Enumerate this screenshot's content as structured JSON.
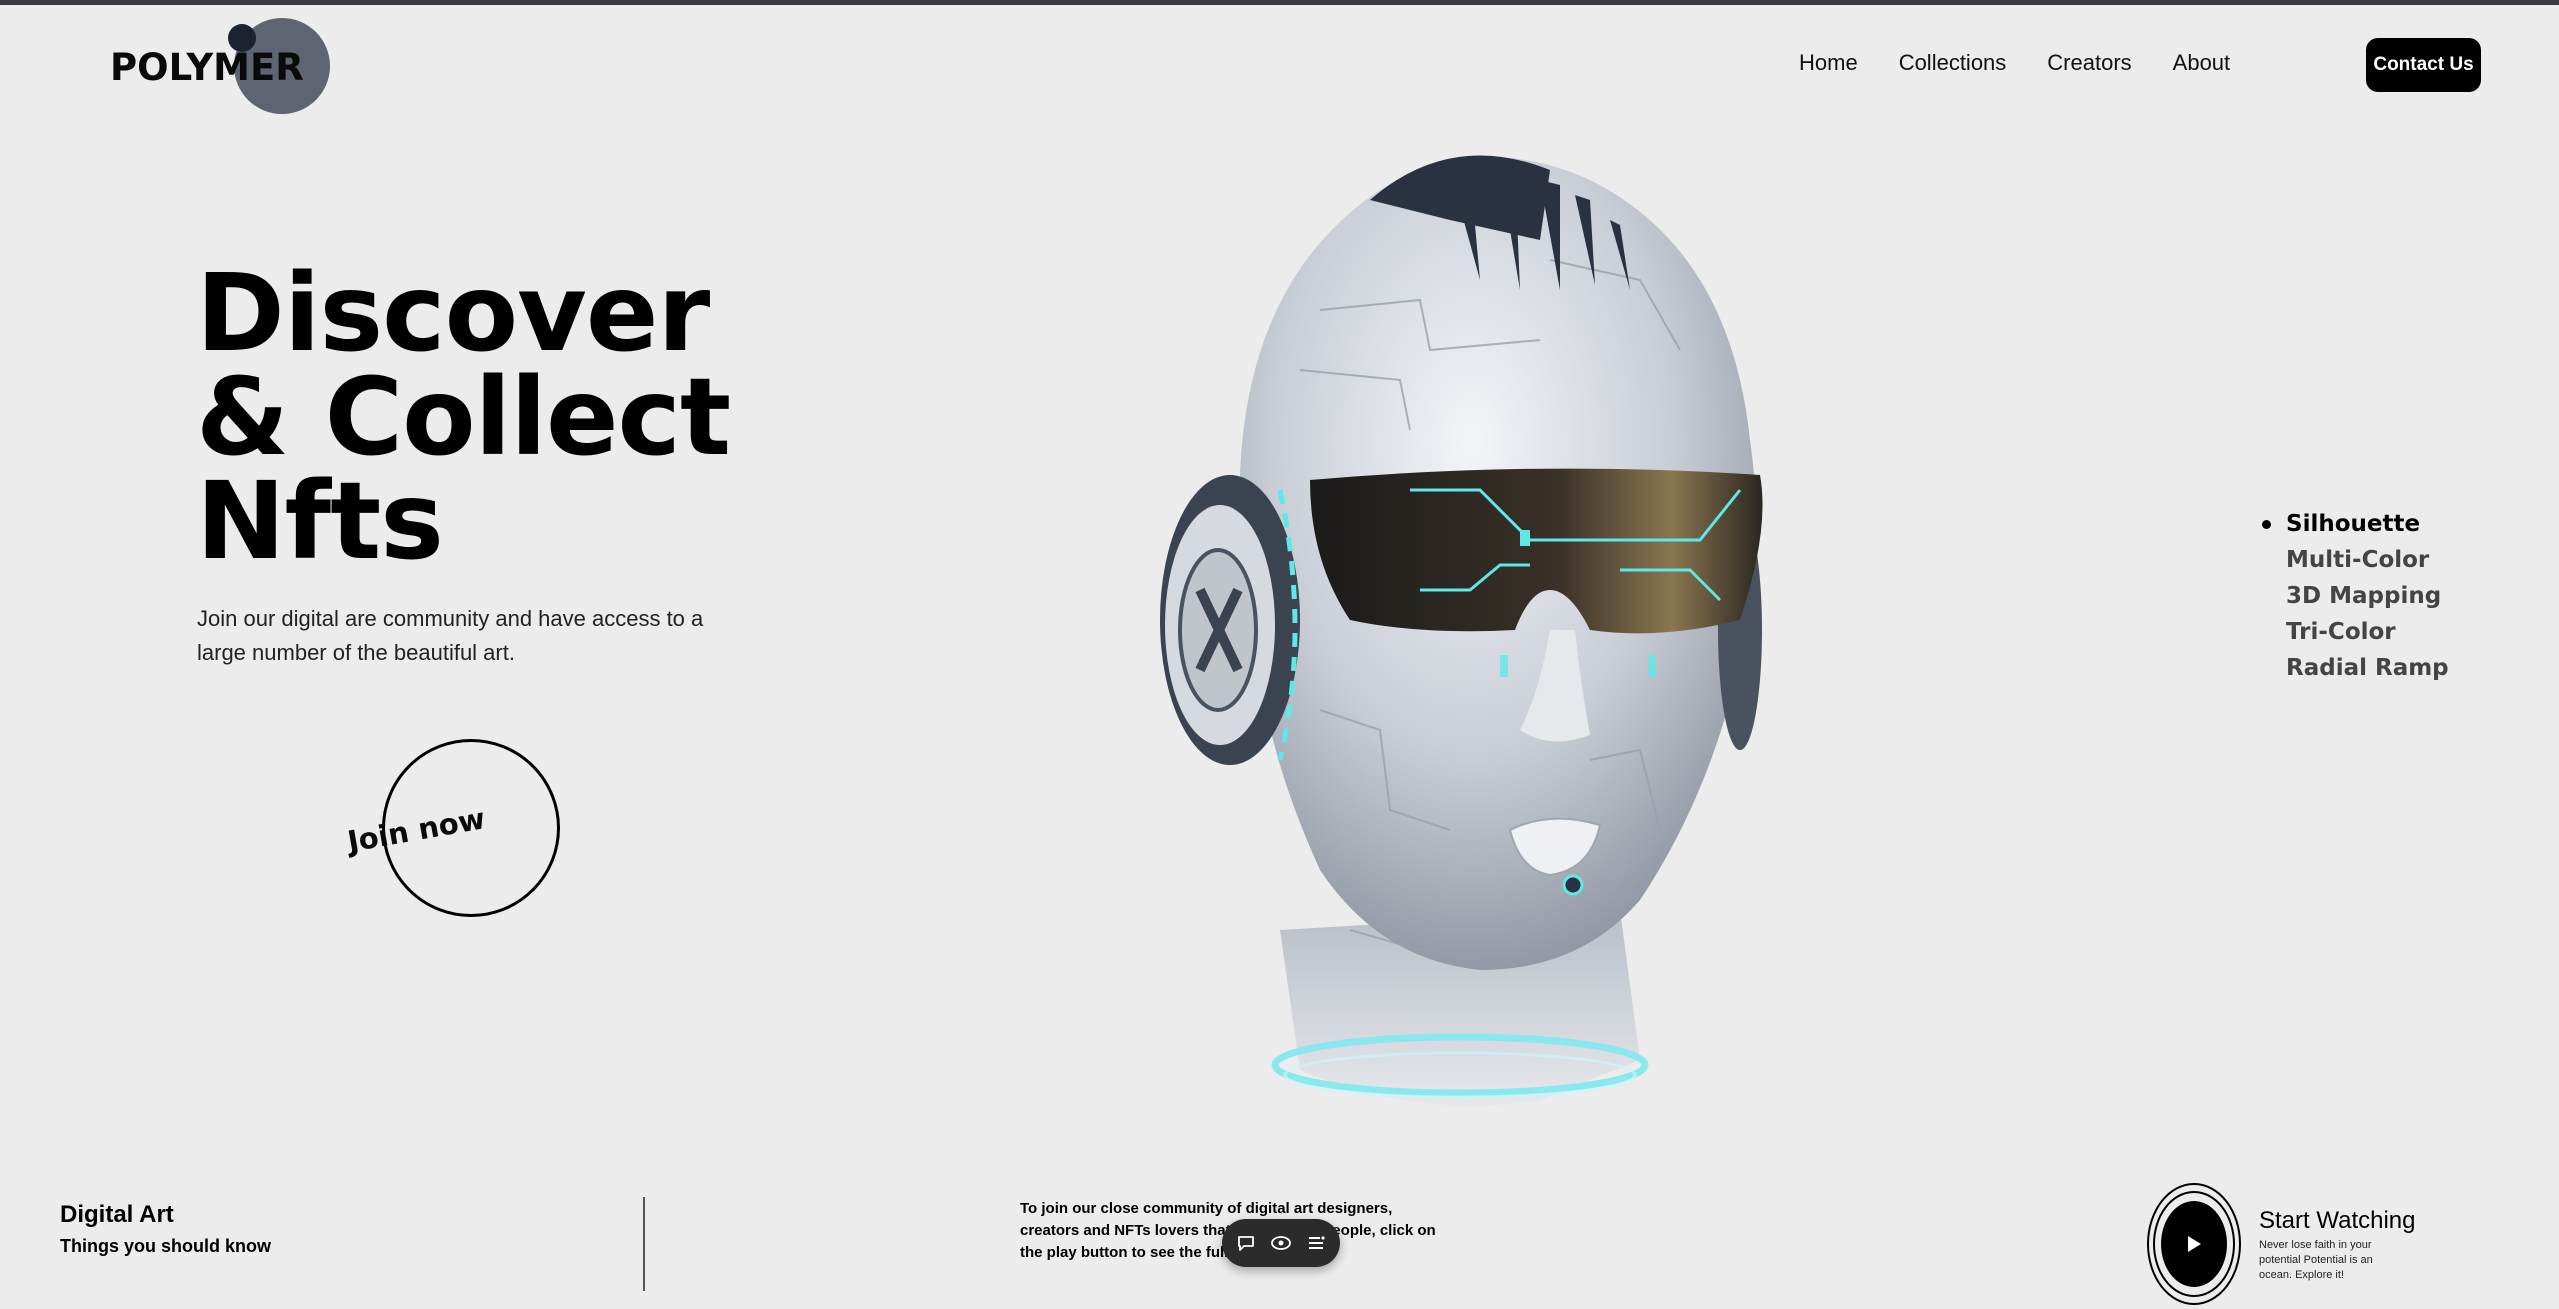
{
  "brand": {
    "name": "POLYMER"
  },
  "nav": {
    "items": [
      {
        "label": "Home"
      },
      {
        "label": "Collections"
      },
      {
        "label": "Creators"
      },
      {
        "label": "About"
      }
    ],
    "contact_label": "Contact Us"
  },
  "hero": {
    "title_line1": "Discover",
    "title_line2": "& Collect",
    "title_line3": "Nfts",
    "subtitle": "Join our digital are community and have access to a large number of the beautiful art.",
    "cta_label": "Join now"
  },
  "styles": {
    "items": [
      {
        "label": "Silhouette",
        "active": true
      },
      {
        "label": "Multi-Color",
        "active": false
      },
      {
        "label": "3D Mapping",
        "active": false
      },
      {
        "label": "Tri-Color",
        "active": false
      },
      {
        "label": "Radial Ramp",
        "active": false
      }
    ]
  },
  "footer": {
    "digital_title": "Digital Art",
    "digital_subtitle": "Things you should know",
    "paragraph": "To join our close community of digital art designers, creators and NFTs lovers that are the best people, click on the play button to see the full video",
    "watch_title": "Start Watching",
    "watch_subtitle": "Never lose faith in your potential Potential is an ocean. Explore it!"
  },
  "toolbar": {
    "icons": [
      "comment-icon",
      "eye-icon",
      "menu-icon"
    ]
  },
  "colors": {
    "background": "#ececec",
    "logo_circle": "#5e6470",
    "logo_dot": "#1d2230",
    "accent_cyan": "#5fe8e8",
    "button_dark": "#000000"
  }
}
